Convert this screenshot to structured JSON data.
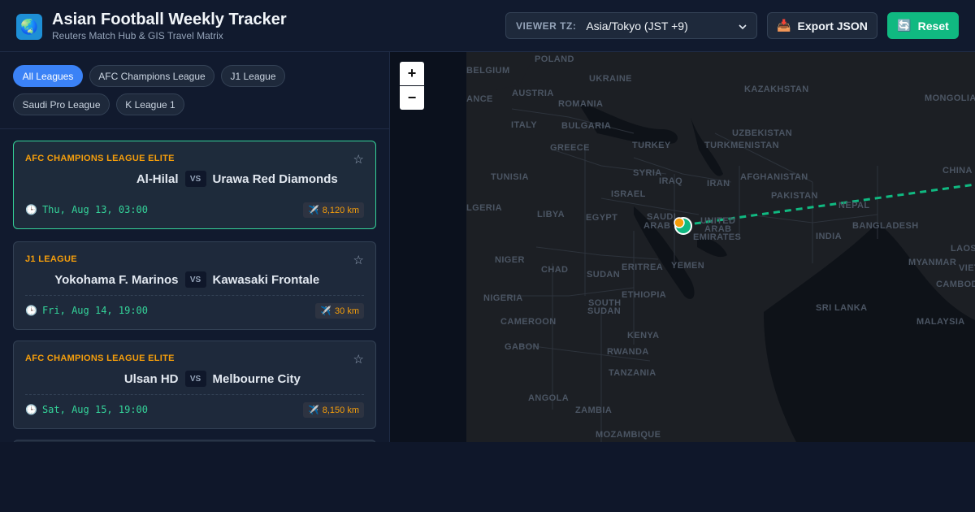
{
  "header": {
    "logo": "globe-icon",
    "title": "Asian Football Weekly Tracker",
    "subtitle": "Reuters Match Hub & GIS Travel Matrix",
    "tz_label": "VIEWER TZ:",
    "tz_value": "Asia/Tokyo (JST +9)",
    "export_icon": "📥",
    "export_label": "Export JSON",
    "reset_icon": "🔄",
    "reset_label": "Reset"
  },
  "filters": [
    "All Leagues",
    "AFC Champions League",
    "J1 League",
    "Saudi Pro League",
    "K League 1"
  ],
  "active_filter": "All Leagues",
  "matches": [
    {
      "league": "AFC CHAMPIONS LEAGUE ELITE",
      "home": "Al-Hilal",
      "vs": "VS",
      "away": "Urawa Red Diamonds",
      "time": "Thu, Aug 13, 03:00",
      "distance": "8,120 km",
      "selected": true
    },
    {
      "league": "J1 LEAGUE",
      "home": "Yokohama F. Marinos",
      "vs": "VS",
      "away": "Kawasaki Frontale",
      "time": "Fri, Aug 14, 19:00",
      "distance": "30 km",
      "selected": false
    },
    {
      "league": "AFC CHAMPIONS LEAGUE ELITE",
      "home": "Ulsan HD",
      "vs": "VS",
      "away": "Melbourne City",
      "time": "Sat, Aug 15, 19:00",
      "distance": "8,150 km",
      "selected": false
    }
  ],
  "icons": {
    "star": "☆",
    "clock": "🕒",
    "plane": "✈️"
  },
  "map": {
    "zoom_in": "+",
    "zoom_out": "−",
    "labels": [
      "POLAND",
      "BELGIUM",
      "UKRAINE",
      "AUSTRIA",
      "KAZAKHSTAN",
      "MONGOLIA",
      "ROMANIA",
      "ANCE",
      "ITALY",
      "BULGARIA",
      "UZBEKISTAN",
      "TURKEY",
      "TURKMENISTAN",
      "GREECE",
      "CHINA",
      "TUNISIA",
      "SYRIA",
      "IRAQ",
      "AFGHANISTAN",
      "IRAN",
      "ISRAEL",
      "PAKISTAN",
      "LGERIA",
      "LIBYA",
      "EGYPT",
      "SAUDI",
      "ARAB",
      "UNITED",
      "ARAB",
      "EMIRATES",
      "NEPAL",
      "BANGLADESH",
      "INDIA",
      "NIGER",
      "CHAD",
      "YEMEN",
      "MYANMAR",
      "VIETNA",
      "ERITREA",
      "SUDAN",
      "CAMBODIA",
      "NIGERIA",
      "ETHIOPIA",
      "SOUTH",
      "SUDAN",
      "SRI LANKA",
      "LAOS",
      "CAMEROON",
      "KENYA",
      "MALAYSIA",
      "GABON",
      "RWANDA",
      "TANZANIA",
      "ANGOLA",
      "ZAMBIA",
      "MOZAMBIQUE"
    ],
    "colors": {
      "route": "#10b981",
      "origin": "#f59e0b",
      "destination": "#10b981"
    }
  }
}
